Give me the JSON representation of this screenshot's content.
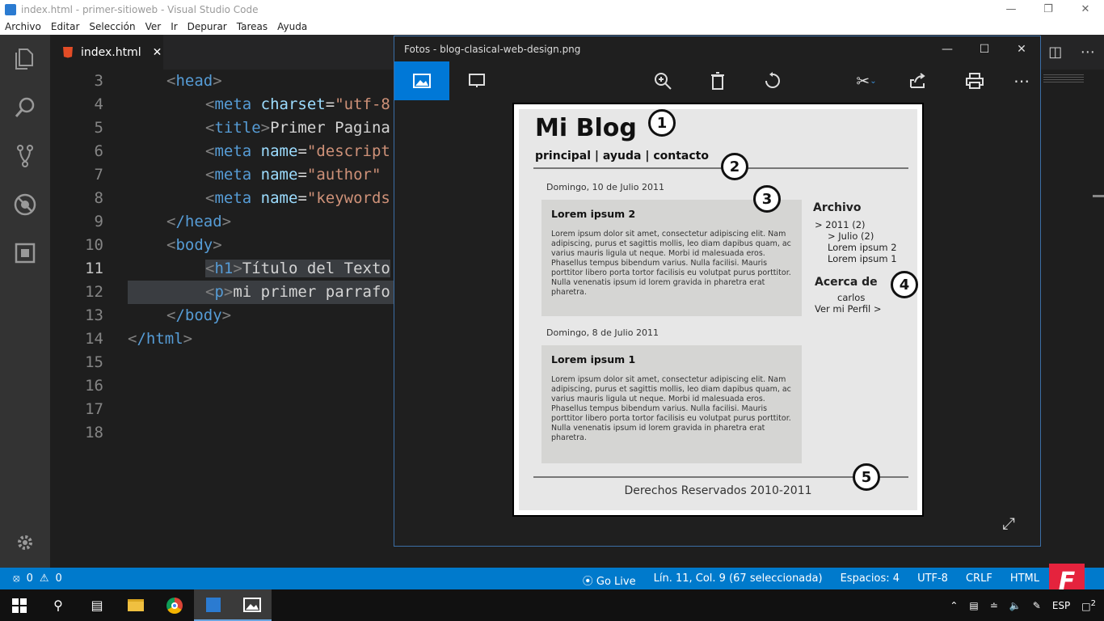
{
  "window": {
    "title": "index.html - primer-sitioweb - Visual Studio Code"
  },
  "menu": [
    "Archivo",
    "Editar",
    "Selección",
    "Ver",
    "Ir",
    "Depurar",
    "Tareas",
    "Ayuda"
  ],
  "tab": {
    "label": "index.html"
  },
  "editor": {
    "lines": [
      {
        "n": "3"
      },
      {
        "n": "4"
      },
      {
        "n": "5"
      },
      {
        "n": "6"
      },
      {
        "n": "7"
      },
      {
        "n": "8"
      },
      {
        "n": "9"
      },
      {
        "n": "10"
      },
      {
        "n": "11"
      },
      {
        "n": "12"
      },
      {
        "n": "13"
      },
      {
        "n": "14"
      },
      {
        "n": "15"
      },
      {
        "n": "16"
      },
      {
        "n": "17"
      },
      {
        "n": "18"
      }
    ],
    "code": {
      "l3_tag": "head",
      "l4_tag": "meta",
      "l4_attr": "charset",
      "l4_str": "\"utf-8",
      "l5_tag": "title",
      "l5_text": "Primer Pagina",
      "l6_tag": "meta",
      "l6_attr": "name",
      "l6_str": "\"descript",
      "l7_tag": "meta",
      "l7_attr": "name",
      "l7_str": "\"author\"",
      "l8_tag": "meta",
      "l8_attr": "name",
      "l8_str": "\"keywords",
      "l9_tag": "/head",
      "l10_tag": "body",
      "l11_tag": "h1",
      "l11_text": "Título del Texto",
      "l12_tag": "p",
      "l12_text": "mi primer parrafo",
      "l13_tag": "/body",
      "l14_tag": "/html"
    }
  },
  "photos": {
    "title": "Fotos - blog-clasical-web-design.png"
  },
  "blog": {
    "title": "Mi Blog",
    "nav": "principal | ayuda | contacto",
    "post2_date": "Domingo, 10 de Julio 2011",
    "post2_title": "Lorem ipsum 2",
    "post1_date": "Domingo, 8 de Julio 2011",
    "post1_title": "Lorem ipsum 1",
    "post_body": "Lorem ipsum dolor sit amet, consectetur adipiscing elit. Nam adipiscing, purus et sagittis mollis, leo diam dapibus quam, ac varius mauris ligula ut neque. Morbi id malesuada eros. Phasellus tempus bibendum varius. Nulla facilisi. Mauris porttitor libero porta tortor facilisis eu volutpat purus porttitor. Nulla venenatis ipsum id lorem gravida in pharetra erat pharetra.",
    "archive_heading": "Archivo",
    "archive_items": [
      "> 2011 (2)",
      "> Julio (2)",
      "Lorem ipsum 2",
      "Lorem ipsum 1"
    ],
    "about_heading": "Acerca de",
    "about_name": "carlos",
    "about_link": "Ver mi Perfil >",
    "footer": "Derechos Reservados 2010-2011",
    "markers": [
      "1",
      "2",
      "3",
      "4",
      "5"
    ]
  },
  "status": {
    "errors": "0",
    "warnings": "0",
    "golive": "Go Live",
    "position": "Lín. 11, Col. 9 (67 seleccionada)",
    "spaces": "Espacios: 4",
    "encoding": "UTF-8",
    "eol": "CRLF",
    "lang": "HTML"
  },
  "tray": {
    "lang": "ESP",
    "notifications": "2"
  },
  "badge": "F"
}
